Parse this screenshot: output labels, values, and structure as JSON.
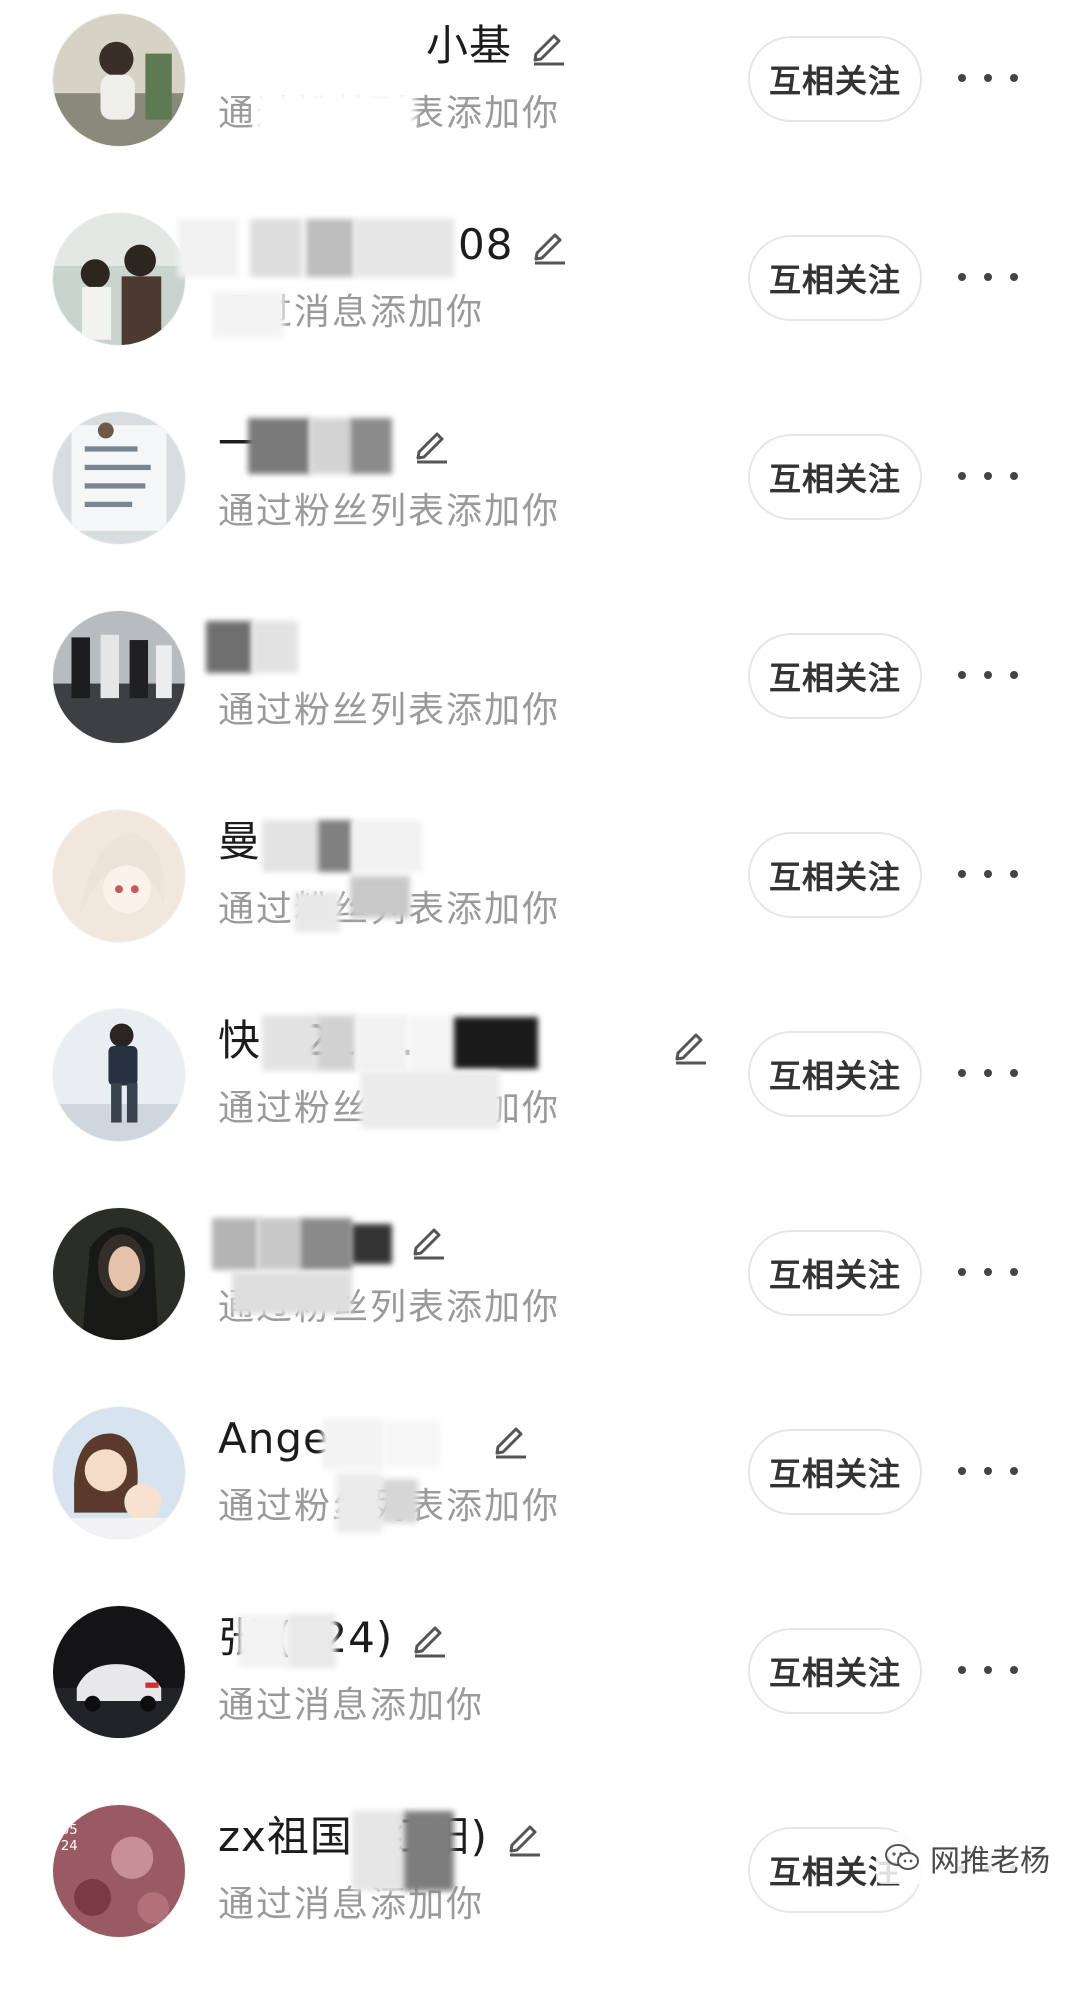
{
  "contacts": [
    {
      "name": "小基",
      "source": "通过粉丝列表添加你",
      "button": "互相关注"
    },
    {
      "name": "08",
      "source": "通过消息添加你",
      "button": "互相关注"
    },
    {
      "name": "一",
      "source": "通过粉丝列表添加你",
      "button": "互相关注"
    },
    {
      "name": "",
      "source": "通过粉丝列表添加你",
      "button": "互相关注"
    },
    {
      "name": "曼",
      "source": "通过粉丝列表添加你",
      "button": "互相关注"
    },
    {
      "name": "快 9210...",
      "source": "通过粉丝列表添加你",
      "button": "互相关注"
    },
    {
      "name": "",
      "source": "通过粉丝列表添加你",
      "button": "互相关注"
    },
    {
      "name": "Ange",
      "source": "通过粉丝列表添加你",
      "button": "互相关注"
    },
    {
      "name": "张 (924)",
      "source": "通过消息添加你",
      "button": "互相关注"
    },
    {
      "name": "zx祖国 (红阳)",
      "source": "通过消息添加你",
      "button": "互相关注"
    }
  ],
  "watermark": "网推老杨",
  "icons": {
    "edit": "pencil-edit-icon",
    "more": "more-dots-icon",
    "watermark": "wechat-icon"
  },
  "colors": {
    "name_text": "#1c1c1c",
    "sub_text": "#9a9a9a",
    "button_border": "#e6e6e6",
    "button_text": "#333333"
  }
}
